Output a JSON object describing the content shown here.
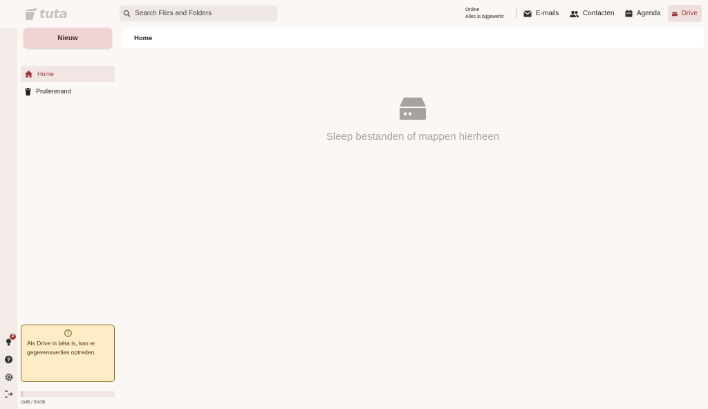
{
  "app": {
    "logo_text": "tuta"
  },
  "search": {
    "placeholder": "Search Files and Folders",
    "value": ""
  },
  "status": {
    "line1": "Online",
    "line2": "Alles is bijgewerkt"
  },
  "nav": {
    "emails": "E-mails",
    "contacts": "Contacten",
    "calendar": "Agenda",
    "drive": "Drive"
  },
  "sidebar": {
    "new_label": "Nieuw",
    "items": [
      {
        "label": "Home",
        "icon": "home-icon",
        "active": true
      },
      {
        "label": "Prullenmand",
        "icon": "trash-icon",
        "active": false
      }
    ],
    "notification_count": "2"
  },
  "breadcrumb": {
    "current": "Home"
  },
  "empty_state": {
    "text": "Sleep bestanden of mappen hierheen",
    "icon": "drive-icon"
  },
  "beta_notice": {
    "text": "Als Drive in bèta is, kan er gegevensverlies optreden."
  },
  "storage": {
    "text": "1MB / 50GB",
    "fraction": 0.02
  },
  "colors": {
    "accent": "#9b3a3f",
    "new_button": "#f1d3d3",
    "beta_bg": "#fdecc6"
  }
}
